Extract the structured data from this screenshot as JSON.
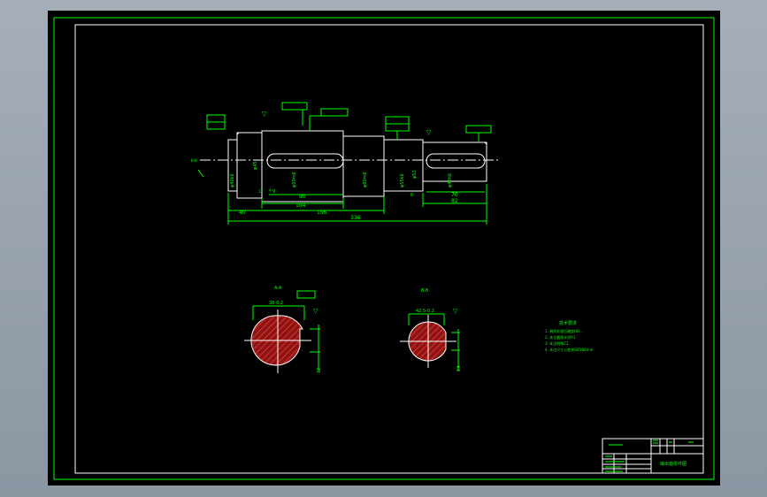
{
  "dims": {
    "d40": "40",
    "d90": "90",
    "d104": "104",
    "d156": "156",
    "d336": "336",
    "d82": "82",
    "d70": "70",
    "d6": "6",
    "d9": "9"
  },
  "sections": {
    "a_label": "A-A",
    "b_label": "B-B",
    "a_width": "12",
    "b_width": "14"
  },
  "notes": {
    "title": "技术要求",
    "lines": [
      "1. 调质处理后硬度HB...",
      "2. 未注圆角半径R1.",
      "3. 未注倒角C1.",
      "4. 未注尺寸公差按GB1804-m."
    ]
  },
  "title_block": {
    "name": "输出轴零件图"
  },
  "colors": {
    "line": "#00ff00",
    "part": "#ffffff",
    "hatch": "#ff3b30",
    "fill": "#8b1414"
  }
}
